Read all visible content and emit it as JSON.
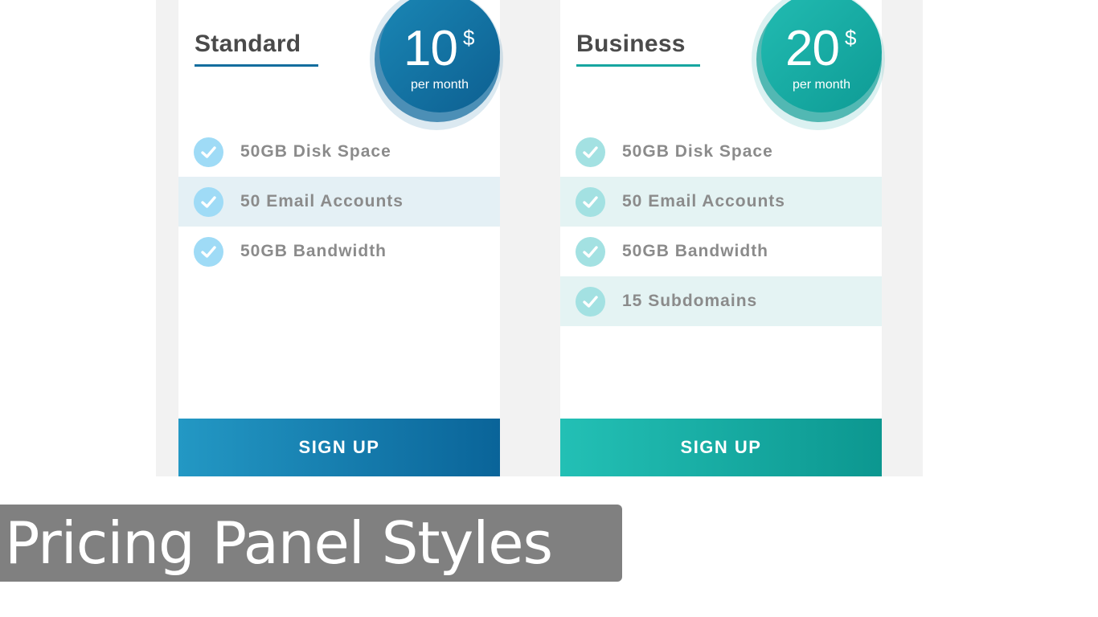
{
  "colors": {
    "standard_accent": "#136d9e",
    "business_accent": "#17a6a0",
    "panel_background": "#f2f2f2",
    "banner_background": "#808080"
  },
  "plans": [
    {
      "name": "Standard",
      "price": "10",
      "currency": "$",
      "period": "per month",
      "features": [
        {
          "label": "50GB Disk Space",
          "icon": "check-icon"
        },
        {
          "label": "50 Email Accounts",
          "icon": "check-icon"
        },
        {
          "label": "50GB Bandwidth",
          "icon": "check-icon"
        }
      ],
      "button_label": "SIGN UP"
    },
    {
      "name": "Business",
      "price": "20",
      "currency": "$",
      "period": "per month",
      "features": [
        {
          "label": "50GB Disk Space",
          "icon": "check-icon"
        },
        {
          "label": "50 Email Accounts",
          "icon": "check-icon"
        },
        {
          "label": "50GB Bandwidth",
          "icon": "check-icon"
        },
        {
          "label": "15 Subdomains",
          "icon": "check-icon"
        }
      ],
      "button_label": "SIGN UP"
    }
  ],
  "banner": {
    "title": "Pricing Panel Styles"
  }
}
